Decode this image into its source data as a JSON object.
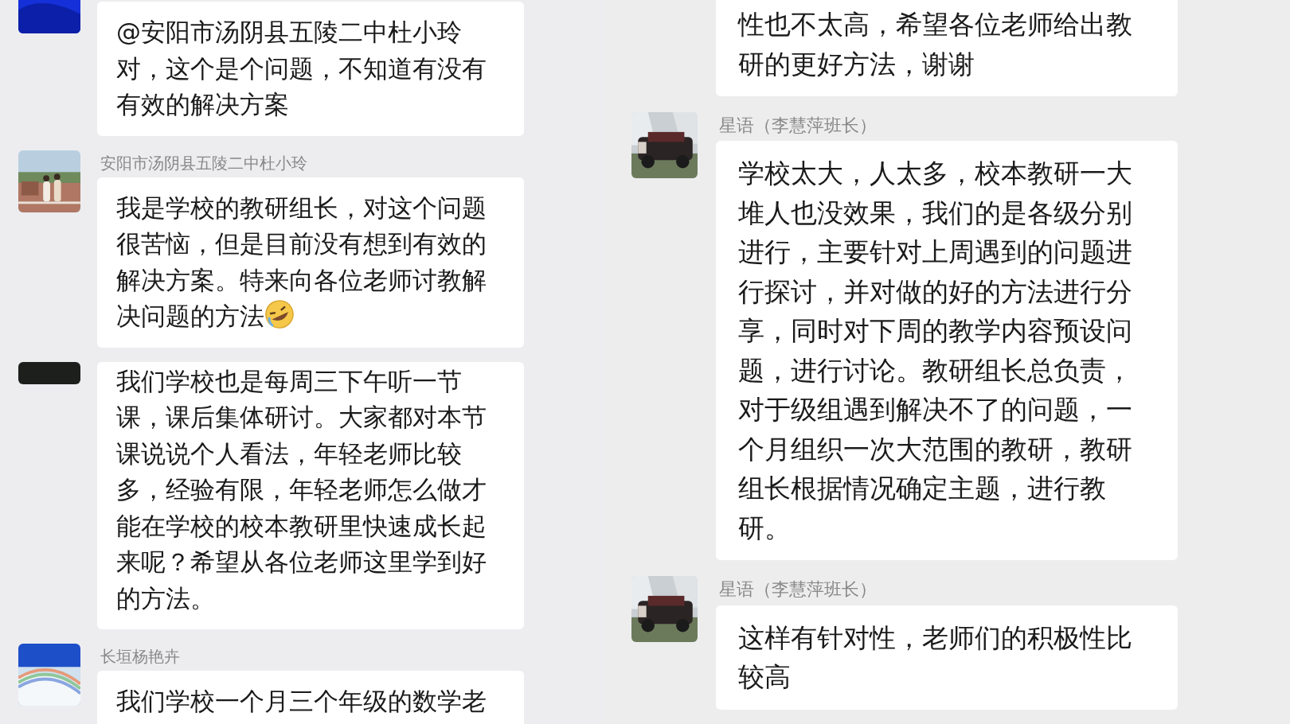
{
  "panels": [
    {
      "messages": [
        {
          "has_avatar": true,
          "avatar_cropped": false,
          "mention": "@安阳市汤阴县五陵二中杜小玲",
          "text": "对，这个是个问题，不知道有没有有效的解决方案"
        },
        {
          "has_avatar": true,
          "avatar_cropped": false,
          "sender": "安阳市汤阴县五陵二中杜小玲",
          "text": "我是学校的教研组长，对这个问题很苦恼，但是目前没有想到有效的解决方案。特来向各位老师讨教解决问题的方法",
          "emoji": true
        },
        {
          "has_avatar": true,
          "avatar_cropped": true,
          "text": "我们学校也是每周三下午听一节课，课后集体研讨。大家都对本节课说说个人看法，年轻老师比较多，经验有限，年轻老师怎么做才能在学校的校本教研里快速成长起来呢？希望从各位老师这里学到好的方法。"
        },
        {
          "has_avatar": true,
          "avatar_cropped": false,
          "sender": "长垣杨艳卉",
          "text": "我们学校一个月三个年级的数学老"
        }
      ]
    },
    {
      "messages": [
        {
          "has_avatar": false,
          "text": "性也不太高，希望各位老师给出教研的更好方法，谢谢"
        },
        {
          "has_avatar": true,
          "avatar_cropped": false,
          "sender": "星语（李慧萍班长）",
          "text": "学校太大，人太多，校本教研一大堆人也没效果，我们的是各级分别进行，主要针对上周遇到的问题进行探讨，并对做的好的方法进行分享，同时对下周的教学内容预设问题，进行讨论。教研组长总负责，对于级组遇到解决不了的问题，一个月组织一次大范围的教研，教研组长根据情况确定主题，进行教研。"
        },
        {
          "has_avatar": true,
          "avatar_cropped": false,
          "sender": "星语（李慧萍班长）",
          "text": "这样有针对性，老师们的积极性比较高"
        }
      ]
    }
  ]
}
